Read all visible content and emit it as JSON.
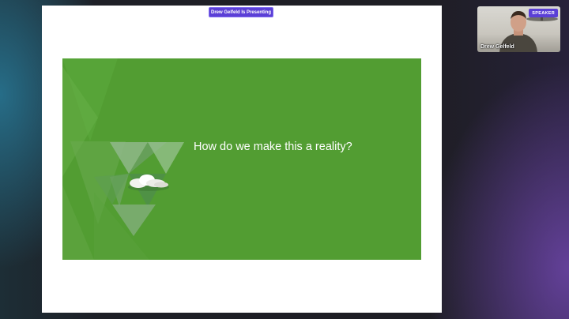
{
  "presenter_badge": "Drew Gelfeld Is Presenting",
  "slide": {
    "title": "How do we make this a reality?",
    "background_color": "#529d32"
  },
  "speaker": {
    "badge": "SPEAKER",
    "name": "Drew Gelfeld"
  },
  "colors": {
    "accent": "#5b3fd6",
    "app_background": "#1e1e24"
  }
}
